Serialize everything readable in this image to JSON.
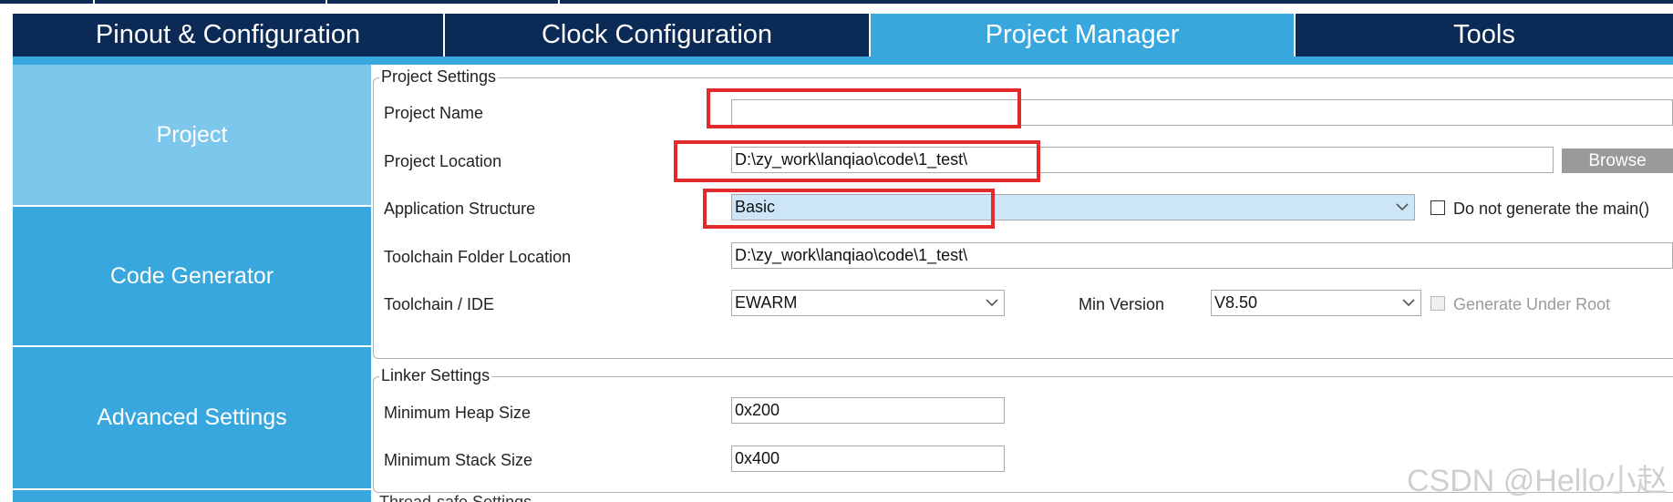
{
  "tabs": [
    {
      "label": "Pinout & Configuration"
    },
    {
      "label": "Clock Configuration"
    },
    {
      "label": "Project Manager"
    },
    {
      "label": "Tools"
    }
  ],
  "sidebar": {
    "items": [
      {
        "label": "Project"
      },
      {
        "label": "Code Generator"
      },
      {
        "label": "Advanced Settings"
      }
    ]
  },
  "project_settings": {
    "title": "Project Settings",
    "project_name": {
      "label": "Project Name",
      "value": ""
    },
    "project_location": {
      "label": "Project Location",
      "value": "D:\\zy_work\\lanqiao\\code\\1_test\\",
      "browse_label": "Browse"
    },
    "application_structure": {
      "label": "Application Structure",
      "value": "Basic",
      "checkbox_label": "Do not generate the main()"
    },
    "toolchain_folder": {
      "label": "Toolchain Folder Location",
      "value": "D:\\zy_work\\lanqiao\\code\\1_test\\"
    },
    "toolchain_ide": {
      "label": "Toolchain / IDE",
      "value": "EWARM",
      "min_version_label": "Min Version",
      "min_version_value": "V8.50",
      "generate_root_label": "Generate Under Root"
    }
  },
  "linker_settings": {
    "title": "Linker Settings",
    "heap": {
      "label": "Minimum Heap Size",
      "value": "0x200"
    },
    "stack": {
      "label": "Minimum Stack Size",
      "value": "0x400"
    }
  },
  "next_group_title_partial": "Thread-safe Settings",
  "watermark": "CSDN @Hello小赵",
  "colors": {
    "tab_dark": "#0b2a55",
    "tab_active": "#38a7de",
    "sidebar_active": "#7dc7ec",
    "annotation_red": "#e32b2b"
  }
}
